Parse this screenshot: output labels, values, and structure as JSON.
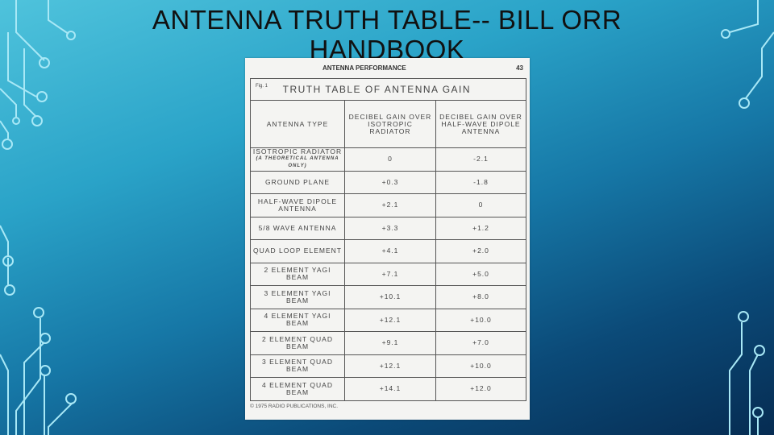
{
  "slide": {
    "title": "ANTENNA TRUTH TABLE-- BILL ORR HANDBOOK"
  },
  "scan": {
    "page_header": "ANTENNA PERFORMANCE",
    "page_number": "43",
    "fig_label": "Fig. 1",
    "table_title": "TRUTH TABLE OF ANTENNA GAIN",
    "columns": [
      "ANTENNA TYPE",
      "DECIBEL GAIN OVER ISOTROPIC RADIATOR",
      "DECIBEL GAIN OVER HALF-WAVE DIPOLE ANTENNA"
    ],
    "rows": [
      {
        "type": "ISOTROPIC RADIATOR",
        "note": "(A THEORETICAL ANTENNA ONLY)",
        "iso": "0",
        "dipole": "-2.1"
      },
      {
        "type": "GROUND PLANE",
        "iso": "+0.3",
        "dipole": "-1.8"
      },
      {
        "type": "HALF-WAVE DIPOLE ANTENNA",
        "iso": "+2.1",
        "dipole": "0"
      },
      {
        "type": "5/8 WAVE ANTENNA",
        "iso": "+3.3",
        "dipole": "+1.2"
      },
      {
        "type": "QUAD LOOP ELEMENT",
        "iso": "+4.1",
        "dipole": "+2.0"
      },
      {
        "type": "2 ELEMENT YAGI BEAM",
        "iso": "+7.1",
        "dipole": "+5.0"
      },
      {
        "type": "3 ELEMENT YAGI BEAM",
        "iso": "+10.1",
        "dipole": "+8.0"
      },
      {
        "type": "4 ELEMENT YAGI BEAM",
        "iso": "+12.1",
        "dipole": "+10.0"
      },
      {
        "type": "2 ELEMENT QUAD BEAM",
        "iso": "+9.1",
        "dipole": "+7.0"
      },
      {
        "type": "3 ELEMENT QUAD BEAM",
        "iso": "+12.1",
        "dipole": "+10.0"
      },
      {
        "type": "4 ELEMENT QUAD BEAM",
        "iso": "+14.1",
        "dipole": "+12.0"
      }
    ],
    "copyright": "© 1975 RADIO PUBLICATIONS, INC."
  },
  "colors": {
    "circuit": "#9fe6f5",
    "background_dark": "#062c52",
    "background_light": "#4fc3dc"
  }
}
